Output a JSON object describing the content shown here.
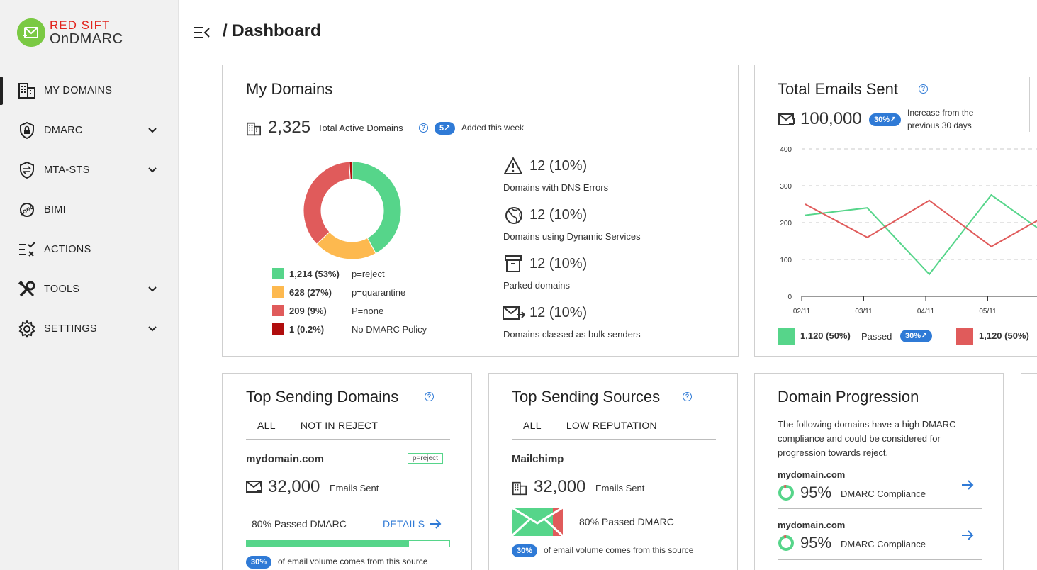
{
  "brand": {
    "line1": "RED SIFT",
    "line2": "OnDMARC"
  },
  "nav": [
    {
      "label": "MY DOMAINS",
      "icon": "building-icon",
      "active": true,
      "chevron": false
    },
    {
      "label": "DMARC",
      "icon": "shield-lock-icon",
      "active": false,
      "chevron": true
    },
    {
      "label": "MTA-STS",
      "icon": "shield-arrows-icon",
      "active": false,
      "chevron": true
    },
    {
      "label": "BIMI",
      "icon": "logo-badge-icon",
      "active": false,
      "chevron": false
    },
    {
      "label": "ACTIONS",
      "icon": "checklist-icon",
      "active": false,
      "chevron": false
    },
    {
      "label": "TOOLS",
      "icon": "wrench-screwdriver-icon",
      "active": false,
      "chevron": true
    },
    {
      "label": "SETTINGS",
      "icon": "gear-icon",
      "active": false,
      "chevron": true
    }
  ],
  "header": {
    "title": "/ Dashboard"
  },
  "my_domains": {
    "title": "My Domains",
    "total": "2,325",
    "total_label": "Total Active Domains",
    "help": "?",
    "added_badge": "5↗",
    "added_label": "Added this week",
    "legend": [
      {
        "value": "1,214 (53%)",
        "label": "p=reject",
        "color": "#56d58a"
      },
      {
        "value": "628 (27%)",
        "label": "p=quarantine",
        "color": "#fdb94f"
      },
      {
        "value": "209 (9%)",
        "label": "P=none",
        "color": "#e05b5b"
      },
      {
        "value": "1 (0.2%)",
        "label": "No DMARC Policy",
        "color": "#b00d0d"
      }
    ],
    "stats": [
      {
        "value": "12 (10%)",
        "label": "Domains with DNS Errors",
        "icon": "warning-icon"
      },
      {
        "value": "12 (10%)",
        "label": "Domains using Dynamic Services",
        "icon": "globe-icon"
      },
      {
        "value": "12 (10%)",
        "label": "Parked domains",
        "icon": "archive-icon"
      },
      {
        "value": "12 (10%)",
        "label": "Domains classed as bulk senders",
        "icon": "mail-forward-icon"
      }
    ]
  },
  "donut_data": {
    "type": "pie",
    "categories": [
      "p=reject",
      "p=quarantine",
      "P=none",
      "No DMARC Policy"
    ],
    "values": [
      42,
      21,
      36,
      1
    ]
  },
  "total_emails": {
    "title": "Total Emails Sent",
    "help": "?",
    "total": "100,000",
    "badge": "30%↗",
    "note_line1": "Increase from the",
    "note_line2": "previous 30 days",
    "legend": [
      {
        "value": "1,120 (50%)",
        "label": "Passed",
        "badge": "30%↗",
        "color": "#56d58a"
      },
      {
        "value": "1,120 (50%)",
        "label": "",
        "badge": "",
        "color": "#e05b5b"
      }
    ]
  },
  "chart_data": {
    "type": "line",
    "x": [
      "02/11",
      "03/11",
      "04/11",
      "05/11",
      ""
    ],
    "series": [
      {
        "values": [
          220,
          240,
          60,
          275,
          155
        ]
      },
      {
        "values": [
          250,
          160,
          260,
          135,
          230
        ]
      }
    ],
    "yticks": [
      0,
      100,
      200,
      300,
      400
    ],
    "ylim": [
      0,
      400
    ],
    "colors": [
      "#56d58a",
      "#e05b5b"
    ],
    "grid": true
  },
  "top_domains": {
    "title": "Top Sending Domains",
    "help": "?",
    "tabs": [
      "ALL",
      "NOT IN REJECT"
    ],
    "domain": "mydomain.com",
    "policy_badge": "p=reject",
    "emails": "32,000",
    "emails_label": "Emails Sent",
    "passed": "80% Passed DMARC",
    "details": "DETAILS",
    "pass_fraction": 0.8,
    "volume_badge": "30%",
    "volume_label": "of email volume comes from this source"
  },
  "top_sources": {
    "title": "Top Sending Sources",
    "help": "?",
    "tabs": [
      "ALL",
      "LOW REPUTATION"
    ],
    "source": "Mailchimp",
    "emails": "32,000",
    "emails_label": "Emails Sent",
    "passed": "80% Passed DMARC",
    "volume_badge": "30%",
    "volume_label": "of email volume comes from this source"
  },
  "progression": {
    "title": "Domain Progression",
    "description_lines": [
      "The following domains have a high DMARC",
      "compliance and could be considered for",
      "progression towards reject."
    ],
    "items": [
      {
        "domain": "mydomain.com",
        "pct": "95%",
        "label": "DMARC Compliance",
        "fraction": 0.95
      },
      {
        "domain": "mydomain.com",
        "pct": "95%",
        "label": "DMARC Compliance",
        "fraction": 0.95
      }
    ]
  }
}
